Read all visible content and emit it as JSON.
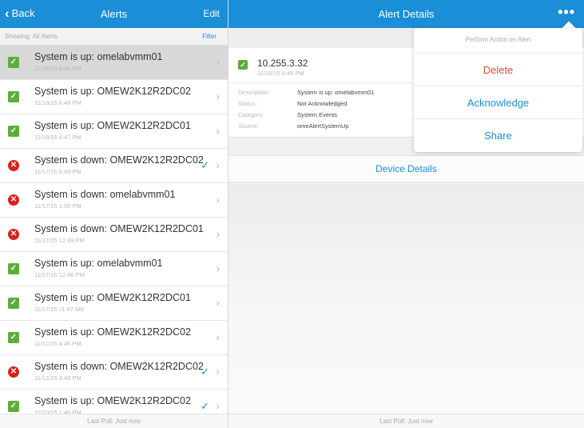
{
  "left_header": {
    "back_label": "Back",
    "title": "Alerts",
    "edit_label": "Edit"
  },
  "right_header": {
    "title": "Alert Details",
    "more_label": "•••"
  },
  "filter_bar": {
    "showing_label": "Showing: All Alerts",
    "filter_label": "Filter"
  },
  "alerts": [
    {
      "status": "ok",
      "title": "System is up: omelabvmm01",
      "time": "11/18/15 6:48 PM",
      "checked": false,
      "selected": true
    },
    {
      "status": "ok",
      "title": "System is up: OMEW2K12R2DC02",
      "time": "11/18/15 6:48 PM",
      "checked": false,
      "selected": false
    },
    {
      "status": "ok",
      "title": "System is up: OMEW2K12R2DC01",
      "time": "11/18/15 4:47 PM",
      "checked": false,
      "selected": false
    },
    {
      "status": "err",
      "title": "System is down: OMEW2K12R2DC02",
      "time": "11/17/15 6:49 PM",
      "checked": true,
      "selected": false
    },
    {
      "status": "err",
      "title": "System is down: omelabvmm01",
      "time": "11/17/15 1:50 PM",
      "checked": false,
      "selected": false
    },
    {
      "status": "err",
      "title": "System is down: OMEW2K12R2DC01",
      "time": "11/17/15 12:49 PM",
      "checked": false,
      "selected": false
    },
    {
      "status": "ok",
      "title": "System is up: omelabvmm01",
      "time": "11/17/15 12:48 PM",
      "checked": false,
      "selected": false
    },
    {
      "status": "ok",
      "title": "System is up: OMEW2K12R2DC01",
      "time": "11/17/15 11:47 AM",
      "checked": false,
      "selected": false
    },
    {
      "status": "ok",
      "title": "System is up: OMEW2K12R2DC02",
      "time": "11/12/15 4:46 PM",
      "checked": false,
      "selected": false
    },
    {
      "status": "err",
      "title": "System is down: OMEW2K12R2DC02",
      "time": "11/12/15 3:48 PM",
      "checked": true,
      "selected": false
    },
    {
      "status": "ok",
      "title": "System is up: OMEW2K12R2DC02",
      "time": "11/10/15 1:46 PM",
      "checked": true,
      "selected": false
    }
  ],
  "footer": {
    "last_poll_left": "Last Poll: Just now",
    "last_poll_right": "Last Poll: Just now"
  },
  "detail": {
    "ip": "10.255.3.32",
    "time": "11/18/15 6:48 PM",
    "fields": [
      {
        "key": "Description:",
        "value": "System is up: omelabvmm01"
      },
      {
        "key": "Status:",
        "value": "Not Acknowledged"
      },
      {
        "key": "Category:",
        "value": "System Events"
      },
      {
        "key": "Source:",
        "value": "omeAlertSystemUp"
      }
    ],
    "device_details_label": "Device Details"
  },
  "popover": {
    "header": "Perform Action on Alert",
    "delete_label": "Delete",
    "acknowledge_label": "Acknowledge",
    "share_label": "Share"
  },
  "colors": {
    "accent": "#1a8ed6",
    "ok": "#5cae3a",
    "error": "#d9221c",
    "delete": "#e04a3f"
  },
  "icons": {
    "back": "chevron-left-icon",
    "more": "more-horizontal-icon",
    "ok": "check-square-icon",
    "error": "x-circle-icon",
    "checked": "checkmark-icon",
    "row": "chevron-right-icon"
  }
}
